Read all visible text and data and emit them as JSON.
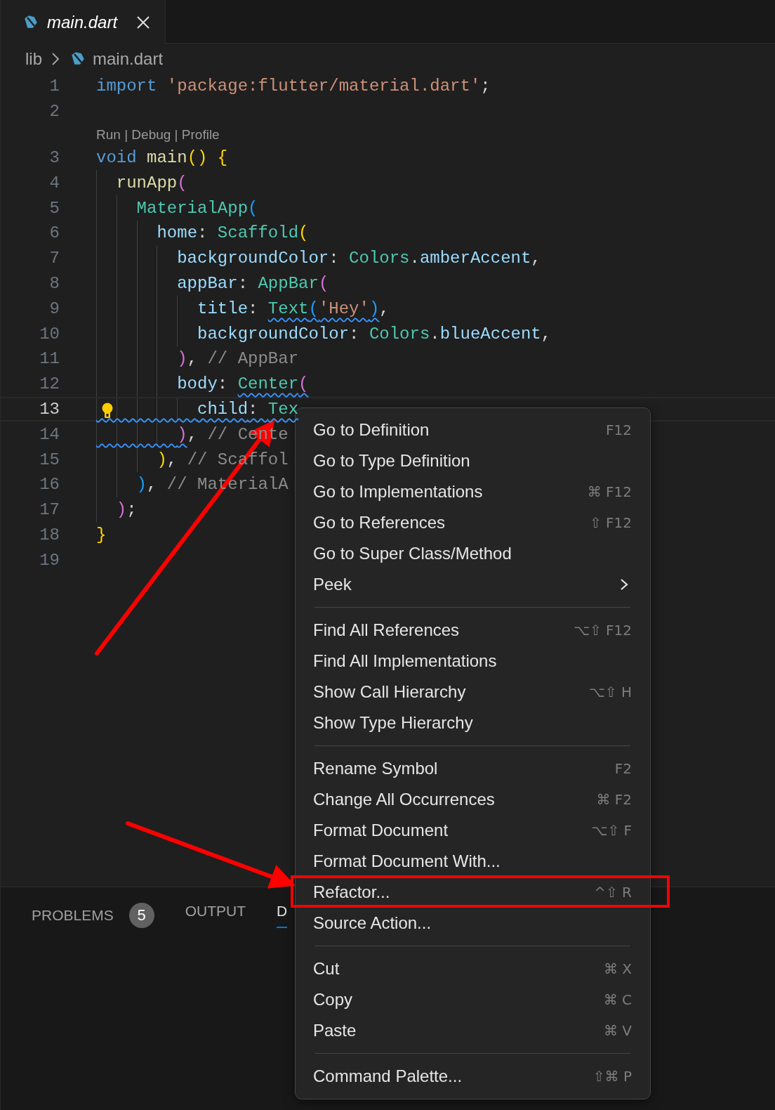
{
  "tabs": [
    {
      "label": "main.dart",
      "selected": true
    }
  ],
  "breadcrumb": [
    "lib",
    "main.dart"
  ],
  "lines": [
    {
      "kind": "code",
      "number": "1",
      "current": false,
      "lightbulb": false,
      "tokens": [
        {
          "text": "import ",
          "kind": "keyword"
        },
        {
          "text": "'package:flutter/material.dart'",
          "kind": "string"
        },
        {
          "text": ";",
          "kind": "plain"
        }
      ]
    },
    {
      "kind": "code",
      "number": "2",
      "current": false,
      "lightbulb": false
    },
    {
      "kind": "codelens",
      "text": "Run | Debug | Profile"
    },
    {
      "kind": "code",
      "number": "3",
      "current": false,
      "lightbulb": false,
      "tokens": [
        {
          "text": "void ",
          "kind": "keyword"
        },
        {
          "text": "main",
          "kind": "function"
        },
        {
          "text": "() ",
          "kind": "bracket1"
        },
        {
          "text": "{",
          "kind": "bracket1"
        }
      ]
    },
    {
      "kind": "code",
      "number": "4",
      "current": false,
      "lightbulb": false,
      "tokens": [
        {
          "text": "  runApp",
          "kind": "function"
        },
        {
          "text": "(",
          "kind": "bracket2"
        }
      ]
    },
    {
      "kind": "code",
      "number": "5",
      "current": false,
      "lightbulb": false,
      "tokens": [
        {
          "text": "    MaterialApp",
          "kind": "class"
        },
        {
          "text": "(",
          "kind": "bracket3"
        }
      ]
    },
    {
      "kind": "code",
      "number": "6",
      "current": false,
      "lightbulb": false,
      "tokens": [
        {
          "text": "      home",
          "kind": "property"
        },
        {
          "text": ": ",
          "kind": "plain"
        },
        {
          "text": "Scaffold",
          "kind": "class"
        },
        {
          "text": "(",
          "kind": "bracket1"
        }
      ]
    },
    {
      "kind": "code",
      "number": "7",
      "current": false,
      "lightbulb": false,
      "tokens": [
        {
          "text": "        backgroundColor",
          "kind": "property"
        },
        {
          "text": ": ",
          "kind": "plain"
        },
        {
          "text": "Colors",
          "kind": "class"
        },
        {
          "text": ".",
          "kind": "plain"
        },
        {
          "text": "amberAccent",
          "kind": "property"
        },
        {
          "text": ",",
          "kind": "plain"
        }
      ]
    },
    {
      "kind": "code",
      "number": "8",
      "current": false,
      "lightbulb": false,
      "tokens": [
        {
          "text": "        appBar",
          "kind": "property"
        },
        {
          "text": ": ",
          "kind": "plain"
        },
        {
          "text": "AppBar",
          "kind": "class"
        },
        {
          "text": "(",
          "kind": "bracket2"
        }
      ]
    },
    {
      "kind": "code",
      "number": "9",
      "current": false,
      "lightbulb": false,
      "tokens": [
        {
          "text": "          title",
          "kind": "property"
        },
        {
          "text": ": ",
          "kind": "plain"
        },
        {
          "text": "Text",
          "kind": "class",
          "squiggle": true
        },
        {
          "text": "(",
          "kind": "bracket3",
          "squiggle": true
        },
        {
          "text": "'Hey'",
          "kind": "string",
          "squiggle": true
        },
        {
          "text": ")",
          "kind": "bracket3",
          "squiggle": true
        },
        {
          "text": ",",
          "kind": "plain"
        }
      ]
    },
    {
      "kind": "code",
      "number": "10",
      "current": false,
      "lightbulb": false,
      "tokens": [
        {
          "text": "          backgroundColor",
          "kind": "property"
        },
        {
          "text": ": ",
          "kind": "plain"
        },
        {
          "text": "Colors",
          "kind": "class"
        },
        {
          "text": ".",
          "kind": "plain"
        },
        {
          "text": "blueAccent",
          "kind": "property"
        },
        {
          "text": ",",
          "kind": "plain"
        }
      ]
    },
    {
      "kind": "code",
      "number": "11",
      "current": false,
      "lightbulb": false,
      "tokens": [
        {
          "text": "        )",
          "kind": "bracket2"
        },
        {
          "text": ", ",
          "kind": "plain"
        },
        {
          "text": "// AppBar",
          "kind": "comment"
        }
      ]
    },
    {
      "kind": "code",
      "number": "12",
      "current": false,
      "lightbulb": false,
      "tokens": [
        {
          "text": "        body",
          "kind": "property"
        },
        {
          "text": ": ",
          "kind": "plain"
        },
        {
          "text": "Center",
          "kind": "class",
          "squiggle": true
        },
        {
          "text": "(",
          "kind": "bracket2",
          "squiggle": true
        }
      ]
    },
    {
      "kind": "code",
      "number": "13",
      "current": true,
      "lightbulb": true,
      "tokens": [
        {
          "text": "          child",
          "kind": "property",
          "squiggle": true
        },
        {
          "text": ": ",
          "kind": "plain",
          "squiggle": true
        },
        {
          "text": "Tex",
          "kind": "class",
          "squiggle": true
        }
      ]
    },
    {
      "kind": "code",
      "number": "14",
      "current": false,
      "lightbulb": false,
      "tokens": [
        {
          "text": "        )",
          "kind": "bracket2",
          "squiggle": true
        },
        {
          "text": ", ",
          "kind": "plain"
        },
        {
          "text": "// Cente",
          "kind": "comment"
        }
      ]
    },
    {
      "kind": "code",
      "number": "15",
      "current": false,
      "lightbulb": false,
      "tokens": [
        {
          "text": "      )",
          "kind": "bracket1"
        },
        {
          "text": ", ",
          "kind": "plain"
        },
        {
          "text": "// Scaffol",
          "kind": "comment"
        }
      ]
    },
    {
      "kind": "code",
      "number": "16",
      "current": false,
      "lightbulb": false,
      "tokens": [
        {
          "text": "    )",
          "kind": "bracket3"
        },
        {
          "text": ", ",
          "kind": "plain"
        },
        {
          "text": "// MaterialA",
          "kind": "comment"
        }
      ]
    },
    {
      "kind": "code",
      "number": "17",
      "current": false,
      "lightbulb": false,
      "tokens": [
        {
          "text": "  )",
          "kind": "bracket2"
        },
        {
          "text": ";",
          "kind": "plain"
        }
      ]
    },
    {
      "kind": "code",
      "number": "18",
      "current": false,
      "lightbulb": false,
      "tokens": [
        {
          "text": "}",
          "kind": "bracket1"
        }
      ]
    },
    {
      "kind": "code",
      "number": "19",
      "current": false,
      "lightbulb": false
    }
  ],
  "panel_tabs": [
    {
      "label": "PROBLEMS",
      "badge": "5",
      "selected": false
    },
    {
      "label": "OUTPUT",
      "selected": false
    },
    {
      "label": "D",
      "selected": true
    }
  ],
  "context_menu": {
    "groups": [
      {
        "items": [
          {
            "label": "Go to Definition",
            "shortcut": "F12",
            "submenu": false
          },
          {
            "label": "Go to Type Definition",
            "submenu": false
          },
          {
            "label": "Go to Implementations",
            "shortcut": "⌘ F12",
            "submenu": false
          },
          {
            "label": "Go to References",
            "shortcut": "⇧ F12",
            "submenu": false
          },
          {
            "label": "Go to Super Class/Method",
            "submenu": false
          },
          {
            "label": "Peek",
            "submenu": true
          }
        ]
      },
      {
        "items": [
          {
            "label": "Find All References",
            "shortcut": "⌥⇧ F12",
            "submenu": false
          },
          {
            "label": "Find All Implementations",
            "submenu": false
          },
          {
            "label": "Show Call Hierarchy",
            "shortcut": "⌥⇧ H",
            "submenu": false
          },
          {
            "label": "Show Type Hierarchy",
            "submenu": false
          }
        ]
      },
      {
        "items": [
          {
            "label": "Rename Symbol",
            "shortcut": "F2",
            "submenu": false
          },
          {
            "label": "Change All Occurrences",
            "shortcut": "⌘ F2",
            "submenu": false
          },
          {
            "label": "Format Document",
            "shortcut": "⌥⇧ F",
            "submenu": false
          },
          {
            "label": "Format Document With...",
            "submenu": false
          },
          {
            "label": "Refactor...",
            "shortcut": "^⇧ R",
            "submenu": false
          },
          {
            "label": "Source Action...",
            "submenu": false
          }
        ]
      },
      {
        "items": [
          {
            "label": "Cut",
            "shortcut": "⌘ X",
            "submenu": false
          },
          {
            "label": "Copy",
            "shortcut": "⌘ C",
            "submenu": false
          },
          {
            "label": "Paste",
            "shortcut": "⌘ V",
            "submenu": false
          }
        ]
      },
      {
        "items": [
          {
            "label": "Command Palette...",
            "shortcut": "⇧⌘ P",
            "submenu": false
          }
        ]
      }
    ]
  },
  "annotations": [
    {
      "kind": "arrow"
    },
    {
      "kind": "arrow"
    },
    {
      "kind": "frame"
    }
  ]
}
